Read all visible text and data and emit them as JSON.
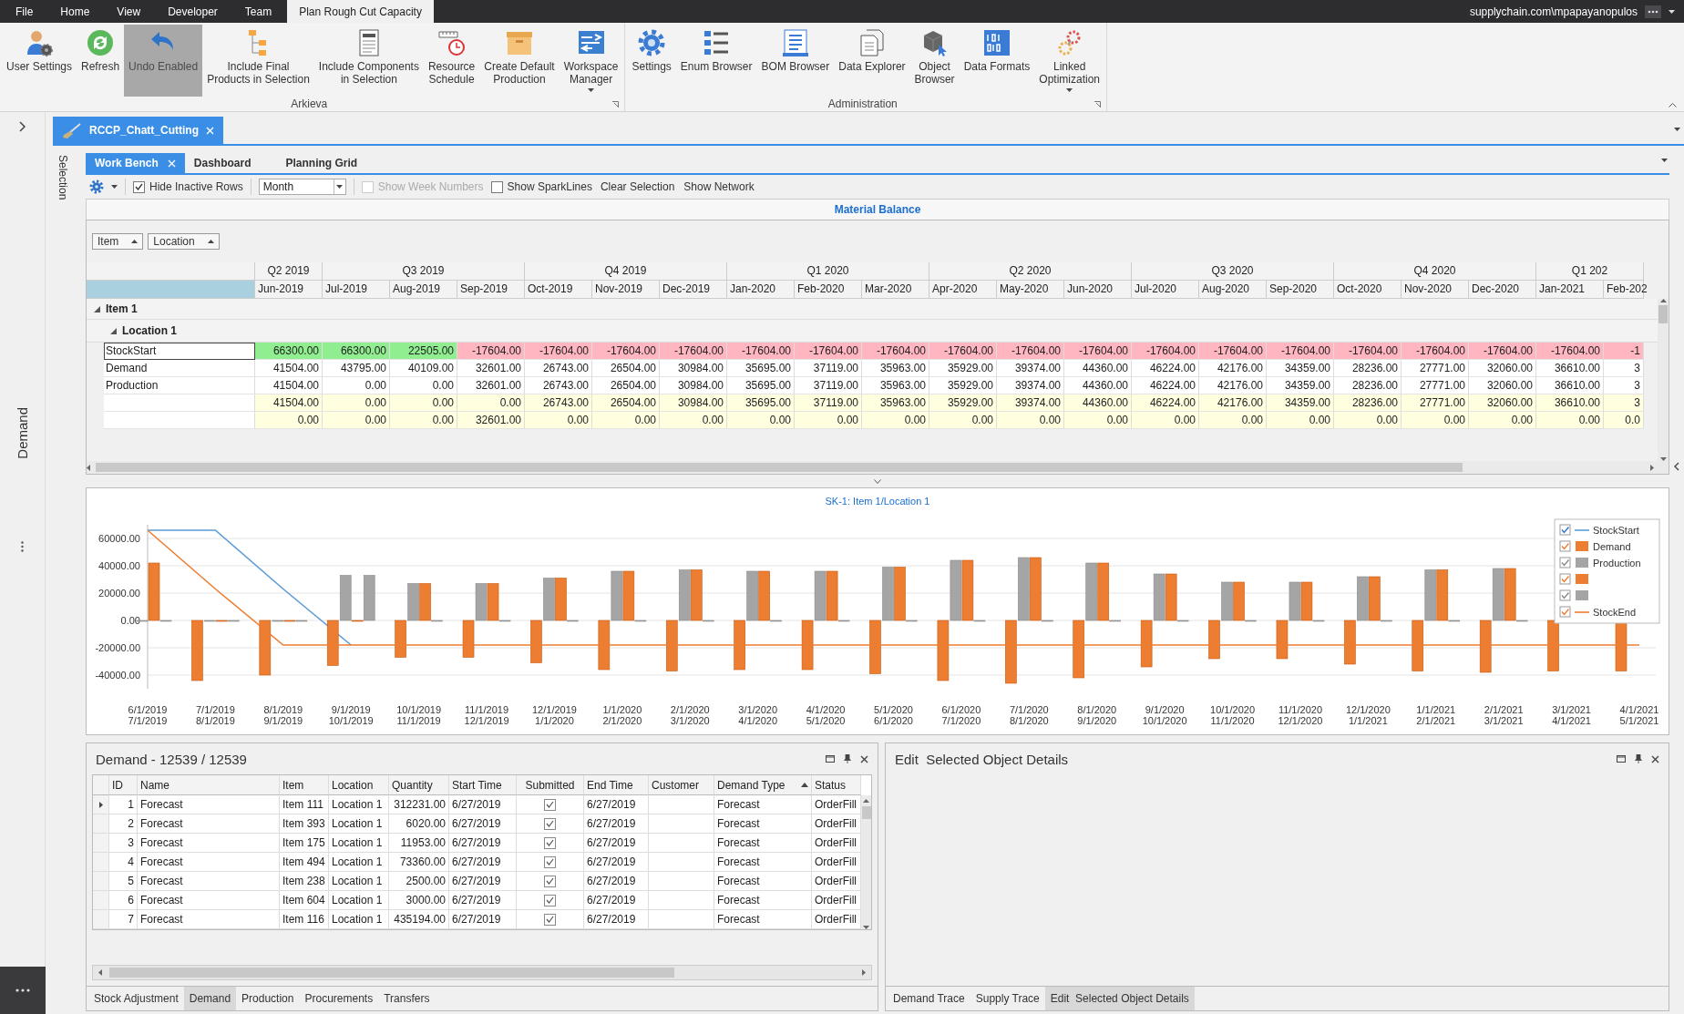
{
  "menu_bar": {
    "tabs": [
      {
        "label": "File",
        "selected": false
      },
      {
        "label": "Home",
        "selected": false
      },
      {
        "label": "View",
        "selected": false
      },
      {
        "label": "Developer",
        "selected": false
      },
      {
        "label": "Team",
        "selected": false
      },
      {
        "label": "Plan Rough Cut Capacity",
        "selected": true
      }
    ],
    "user": "supplychain.com\\mpapayanopulos"
  },
  "ribbon": {
    "groups": [
      {
        "title": "Arkieva",
        "items": [
          {
            "lines": [
              "User Settings"
            ],
            "pressed": false,
            "dropdown": false
          },
          {
            "lines": [
              "Refresh"
            ],
            "pressed": false,
            "dropdown": false
          },
          {
            "lines": [
              "Undo Enabled"
            ],
            "pressed": true,
            "dropdown": false
          },
          {
            "lines": [
              "Include Final",
              "Products in Selection"
            ],
            "pressed": false,
            "dropdown": false
          },
          {
            "lines": [
              "Include Components",
              "in Selection"
            ],
            "pressed": false,
            "dropdown": false
          },
          {
            "lines": [
              "Resource",
              "Schedule"
            ],
            "pressed": false,
            "dropdown": false
          },
          {
            "lines": [
              "Create Default",
              "Production"
            ],
            "pressed": false,
            "dropdown": false
          },
          {
            "lines": [
              "Workspace",
              "Manager"
            ],
            "pressed": false,
            "dropdown": true
          }
        ]
      },
      {
        "title": "Administration",
        "items": [
          {
            "lines": [
              "Settings"
            ],
            "pressed": false,
            "dropdown": false
          },
          {
            "lines": [
              "Enum Browser"
            ],
            "pressed": false,
            "dropdown": false
          },
          {
            "lines": [
              "BOM Browser"
            ],
            "pressed": false,
            "dropdown": false
          },
          {
            "lines": [
              "Data Explorer"
            ],
            "pressed": false,
            "dropdown": false
          },
          {
            "lines": [
              "Object",
              "Browser"
            ],
            "pressed": false,
            "dropdown": false
          },
          {
            "lines": [
              "Data Formats"
            ],
            "pressed": false,
            "dropdown": false
          },
          {
            "lines": [
              "Linked",
              "Optimization"
            ],
            "pressed": false,
            "dropdown": true
          }
        ]
      }
    ]
  },
  "side_bar": {
    "label": "Demand"
  },
  "document_tabs": [
    {
      "label": "RCCP_Chatt_Cutting",
      "selected": true
    }
  ],
  "selection_strip": {
    "label": "Selection"
  },
  "view_tabs": [
    {
      "label": "Work Bench",
      "selected": true
    },
    {
      "label": "Dashboard",
      "selected": false
    },
    {
      "label": "Planning Grid",
      "selected": false
    }
  ],
  "toolbar": {
    "items": [
      {
        "kind": "checkbox",
        "label": "Hide Inactive Rows",
        "checked": true,
        "disabled": false
      },
      {
        "kind": "combo",
        "value": "Month"
      },
      {
        "kind": "checkbox",
        "label": "Show Week Numbers",
        "checked": false,
        "disabled": true
      },
      {
        "kind": "checkbox",
        "label": "Show SparkLines",
        "checked": false,
        "disabled": false
      },
      {
        "kind": "button",
        "label": "Clear Selection"
      },
      {
        "kind": "button",
        "label": "Show Network"
      }
    ]
  },
  "material_balance": {
    "title": "Material Balance",
    "group_by": [
      {
        "label": "Item"
      },
      {
        "label": "Location"
      }
    ],
    "quarters": [
      {
        "label": "Q2 2019",
        "months": [
          "Jun-2019"
        ]
      },
      {
        "label": "Q3 2019",
        "months": [
          "Jul-2019",
          "Aug-2019",
          "Sep-2019"
        ]
      },
      {
        "label": "Q4 2019",
        "months": [
          "Oct-2019",
          "Nov-2019",
          "Dec-2019"
        ]
      },
      {
        "label": "Q1 2020",
        "months": [
          "Jan-2020",
          "Feb-2020",
          "Mar-2020"
        ]
      },
      {
        "label": "Q2 2020",
        "months": [
          "Apr-2020",
          "May-2020",
          "Jun-2020"
        ]
      },
      {
        "label": "Q3 2020",
        "months": [
          "Jul-2020",
          "Aug-2020",
          "Sep-2020"
        ]
      },
      {
        "label": "Q4 2020",
        "months": [
          "Oct-2020",
          "Nov-2020",
          "Dec-2020"
        ]
      },
      {
        "label": "Q1 202",
        "months": [
          "Jan-2021",
          "Feb-202"
        ]
      }
    ],
    "groups": [
      {
        "label": "Item 1",
        "expanded": true,
        "children": [
          {
            "label": "Location 1",
            "expanded": true,
            "rows": [
              {
                "name": "StockStart",
                "kind": "stock",
                "selected": true,
                "values": [
                  "66300.00",
                  "66300.00",
                  "22505.00",
                  "-17604.00",
                  "-17604.00",
                  "-17604.00",
                  "-17604.00",
                  "-17604.00",
                  "-17604.00",
                  "-17604.00",
                  "-17604.00",
                  "-17604.00",
                  "-17604.00",
                  "-17604.00",
                  "-17604.00",
                  "-17604.00",
                  "-17604.00",
                  "-17604.00",
                  "-17604.00",
                  "-17604.00",
                  "-1"
                ]
              },
              {
                "name": "Demand",
                "kind": "plain",
                "selected": false,
                "values": [
                  "41504.00",
                  "43795.00",
                  "40109.00",
                  "32601.00",
                  "26743.00",
                  "26504.00",
                  "30984.00",
                  "35695.00",
                  "37119.00",
                  "35963.00",
                  "35929.00",
                  "39374.00",
                  "44360.00",
                  "46224.00",
                  "42176.00",
                  "34359.00",
                  "28236.00",
                  "27771.00",
                  "32060.00",
                  "36610.00",
                  "3"
                ]
              },
              {
                "name": "Production",
                "kind": "plain",
                "selected": false,
                "values": [
                  "41504.00",
                  "0.00",
                  "0.00",
                  "32601.00",
                  "26743.00",
                  "26504.00",
                  "30984.00",
                  "35695.00",
                  "37119.00",
                  "35963.00",
                  "35929.00",
                  "39374.00",
                  "44360.00",
                  "46224.00",
                  "42176.00",
                  "34359.00",
                  "28236.00",
                  "27771.00",
                  "32060.00",
                  "36610.00",
                  "3"
                ]
              },
              {
                "kind": "summary",
                "selected": false,
                "values": [
                  "41504.00",
                  "0.00",
                  "0.00",
                  "0.00",
                  "26743.00",
                  "26504.00",
                  "30984.00",
                  "35695.00",
                  "37119.00",
                  "35963.00",
                  "35929.00",
                  "39374.00",
                  "44360.00",
                  "46224.00",
                  "42176.00",
                  "34359.00",
                  "28236.00",
                  "27771.00",
                  "32060.00",
                  "36610.00",
                  "3"
                ]
              },
              {
                "kind": "summary",
                "selected": false,
                "values": [
                  "0.00",
                  "0.00",
                  "0.00",
                  "32601.00",
                  "0.00",
                  "0.00",
                  "0.00",
                  "0.00",
                  "0.00",
                  "0.00",
                  "0.00",
                  "0.00",
                  "0.00",
                  "0.00",
                  "0.00",
                  "0.00",
                  "0.00",
                  "0.00",
                  "0.00",
                  "0.00",
                  "0.0"
                ]
              }
            ]
          }
        ]
      }
    ]
  },
  "chart": {
    "chart_data": {
      "type": "bar",
      "title": "SK-1: Item 1/Location 1",
      "stacked": false,
      "categories": [
        "6/1/2019\n7/1/2019",
        "7/1/2019\n8/1/2019",
        "8/1/2019\n9/1/2019",
        "9/1/2019\n10/1/2019",
        "10/1/2019\n11/1/2019",
        "11/1/2019\n12/1/2019",
        "12/1/2019\n1/1/2020",
        "1/1/2020\n2/1/2020",
        "2/1/2020\n3/1/2020",
        "3/1/2020\n4/1/2020",
        "4/1/2020\n5/1/2020",
        "5/1/2020\n6/1/2020",
        "6/1/2020\n7/1/2020",
        "7/1/2020\n8/1/2020",
        "8/1/2020\n9/1/2020",
        "9/1/2020\n10/1/2020",
        "10/1/2020\n11/1/2020",
        "11/1/2020\n12/1/2020",
        "12/1/2020\n1/1/2021",
        "1/1/2021\n2/1/2021",
        "2/1/2021\n3/1/2021",
        "3/1/2021\n4/1/2021",
        "4/1/2021\n5/1/2021"
      ],
      "ylim": [
        -50000,
        70000
      ],
      "grid": true,
      "legend": "top-right",
      "yticks": [
        {
          "value": 60000,
          "label": "60000.00"
        },
        {
          "value": 40000,
          "label": "40000.00"
        },
        {
          "value": 20000,
          "label": "20000.00"
        },
        {
          "value": 0,
          "label": "0.00"
        },
        {
          "value": -20000,
          "label": "-20000.00"
        },
        {
          "value": -40000,
          "label": "-40000.00"
        }
      ],
      "series": [
        {
          "name": "StockStart",
          "type": "line",
          "color": "#5b9bd5",
          "values": [
            66000,
            66000,
            23000,
            -18000,
            null,
            null,
            null,
            null,
            null,
            null,
            null,
            null,
            null,
            null,
            null,
            null,
            null,
            null,
            null,
            null,
            null,
            null,
            null
          ]
        },
        {
          "name": "Demand",
          "type": "bar",
          "color": "#ed7d31",
          "values": [
            null,
            -44000,
            -40000,
            -33000,
            -27000,
            -27000,
            -31000,
            -36000,
            -37000,
            -36000,
            -36000,
            -39000,
            -44000,
            -46000,
            -42000,
            -34000,
            -28000,
            -28000,
            -32000,
            -37000,
            -38000,
            -37000,
            -37000
          ]
        },
        {
          "name": "Production",
          "type": "bar",
          "color": "#a5a5a5",
          "values": [
            0,
            0,
            0,
            33000,
            27000,
            27000,
            31000,
            36000,
            37000,
            36000,
            36000,
            39000,
            44000,
            46000,
            42000,
            34000,
            28000,
            28000,
            32000,
            37000,
            38000,
            null,
            null
          ]
        },
        {
          "type": "bar",
          "color": "#ed7d31",
          "values": [
            42000,
            0,
            0,
            0,
            27000,
            27000,
            31000,
            36000,
            37000,
            36000,
            36000,
            39000,
            44000,
            46000,
            42000,
            34000,
            28000,
            28000,
            32000,
            37000,
            38000,
            null,
            null
          ]
        },
        {
          "type": "bar",
          "color": "#a5a5a5",
          "values": [
            0,
            0,
            0,
            33000,
            0,
            0,
            0,
            0,
            0,
            0,
            0,
            0,
            0,
            0,
            0,
            0,
            0,
            0,
            0,
            0,
            0,
            0,
            null
          ]
        },
        {
          "name": "StockEnd",
          "type": "line",
          "color": "#ed7d31",
          "values": [
            66000,
            23000,
            -18000,
            -18000,
            -18000,
            -18000,
            -18000,
            -18000,
            -18000,
            -18000,
            -18000,
            -18000,
            -18000,
            -18000,
            -18000,
            -18000,
            -18000,
            -18000,
            -18000,
            -18000,
            -18000,
            -18000,
            -18000
          ]
        }
      ]
    },
    "legend": [
      {
        "checked": true
      },
      {
        "checked": true
      },
      {
        "checked": true
      },
      {
        "checked": true
      },
      {
        "checked": true
      },
      {
        "checked": true
      }
    ]
  },
  "demand_panel": {
    "title": "Demand - 12539 / 12539",
    "columns": [
      {
        "label": "ID",
        "sorted": false
      },
      {
        "label": "Name",
        "sorted": false
      },
      {
        "label": "Item",
        "sorted": false
      },
      {
        "label": "Location",
        "sorted": false
      },
      {
        "label": "Quantity",
        "sorted": false
      },
      {
        "label": "Start Time",
        "sorted": false
      },
      {
        "label": "Submitted",
        "sorted": false
      },
      {
        "label": "End Time",
        "sorted": false
      },
      {
        "label": "Customer",
        "sorted": false
      },
      {
        "label": "Demand Type",
        "sorted": true
      },
      {
        "label": "Status",
        "sorted": false
      }
    ],
    "rows": [
      {
        "selected": true,
        "cells": [
          "1",
          "Forecast",
          "Item 111",
          "Location 1",
          "312231.00",
          "6/27/2019",
          true,
          "6/27/2019",
          null,
          "Forecast",
          "OrderFill"
        ]
      },
      {
        "selected": false,
        "cells": [
          "2",
          "Forecast",
          "Item 393",
          "Location 1",
          "6020.00",
          "6/27/2019",
          true,
          "6/27/2019",
          null,
          "Forecast",
          "OrderFill"
        ]
      },
      {
        "selected": false,
        "cells": [
          "3",
          "Forecast",
          "Item 175",
          "Location 1",
          "11953.00",
          "6/27/2019",
          true,
          "6/27/2019",
          null,
          "Forecast",
          "OrderFill"
        ]
      },
      {
        "selected": false,
        "cells": [
          "4",
          "Forecast",
          "Item 494",
          "Location 1",
          "73360.00",
          "6/27/2019",
          true,
          "6/27/2019",
          null,
          "Forecast",
          "OrderFill"
        ]
      },
      {
        "selected": false,
        "cells": [
          "5",
          "Forecast",
          "Item 238",
          "Location 1",
          "2500.00",
          "6/27/2019",
          true,
          "6/27/2019",
          null,
          "Forecast",
          "OrderFill"
        ]
      },
      {
        "selected": false,
        "cells": [
          "6",
          "Forecast",
          "Item 604",
          "Location 1",
          "3000.00",
          "6/27/2019",
          true,
          "6/27/2019",
          null,
          "Forecast",
          "OrderFill"
        ]
      },
      {
        "selected": false,
        "cells": [
          "7",
          "Forecast",
          "Item 116",
          "Location 1",
          "435194.00",
          "6/27/2019",
          true,
          "6/27/2019",
          null,
          "Forecast",
          "OrderFill"
        ]
      }
    ],
    "tabs": [
      {
        "label": "Stock Adjustment",
        "selected": false
      },
      {
        "label": "Demand",
        "selected": true
      },
      {
        "label": "Production",
        "selected": false
      },
      {
        "label": "Procurements",
        "selected": false
      },
      {
        "label": "Transfers",
        "selected": false
      }
    ]
  },
  "details_panel": {
    "title": "Edit  Selected Object Details",
    "tabs": [
      {
        "label": "Demand Trace",
        "selected": false
      },
      {
        "label": "Supply Trace",
        "selected": false
      },
      {
        "label": "Edit  Selected Object Details",
        "selected": true
      }
    ]
  }
}
